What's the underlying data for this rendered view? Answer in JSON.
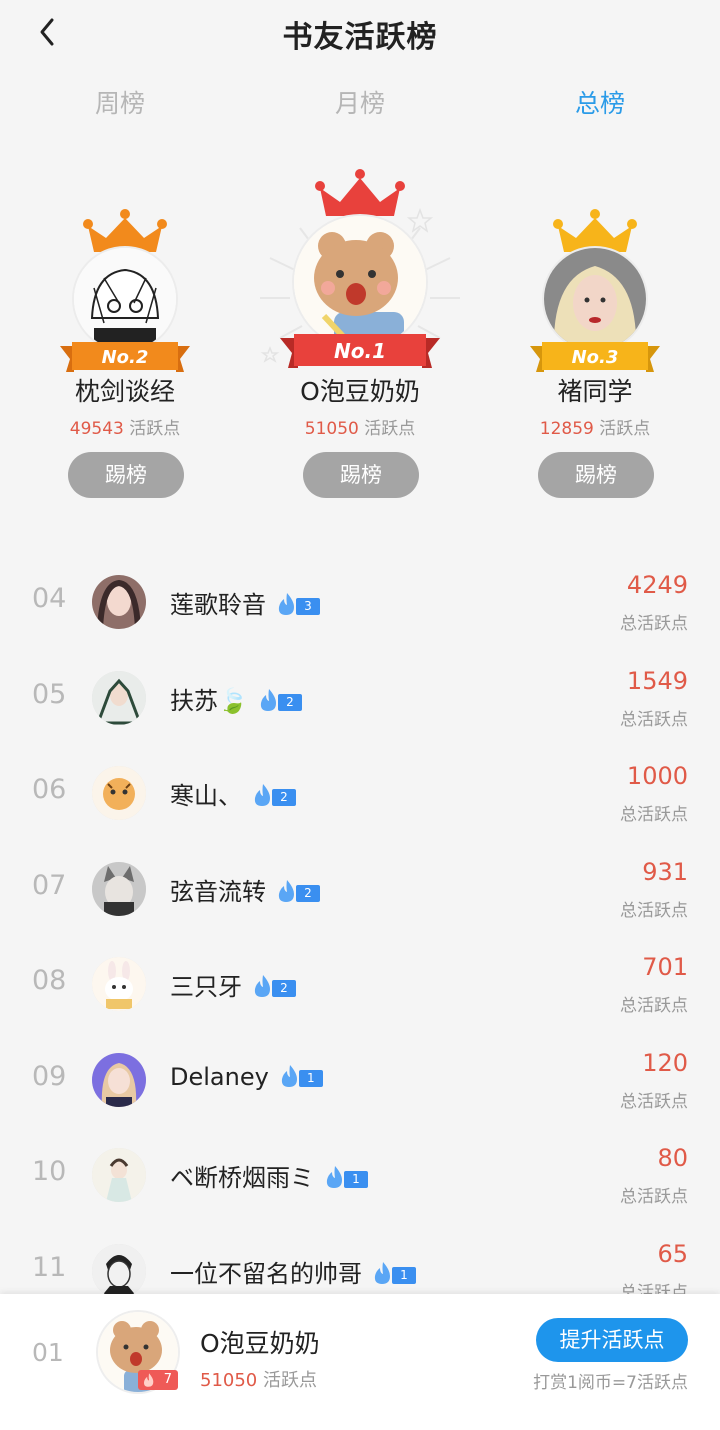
{
  "header": {
    "title": "书友活跃榜"
  },
  "tabs": [
    {
      "label": "周榜",
      "active": false
    },
    {
      "label": "月榜",
      "active": false
    },
    {
      "label": "总榜",
      "active": true
    }
  ],
  "podium": {
    "first": {
      "rank": "No.1",
      "name": "O泡豆奶奶",
      "score": "51050",
      "unit": "活跃点",
      "kick": "踢榜"
    },
    "second": {
      "rank": "No.2",
      "name": "枕剑谈经",
      "score": "49543",
      "unit": "活跃点",
      "kick": "踢榜"
    },
    "third": {
      "rank": "No.3",
      "name": "褚同学",
      "score": "12859",
      "unit": "活跃点",
      "kick": "踢榜"
    }
  },
  "list": [
    {
      "rank": "04",
      "name": "莲歌聆音",
      "level": "3",
      "score": "4249",
      "label": "总活跃点"
    },
    {
      "rank": "05",
      "name": "扶苏🍃",
      "level": "2",
      "score": "1549",
      "label": "总活跃点"
    },
    {
      "rank": "06",
      "name": "寒山、",
      "level": "2",
      "score": "1000",
      "label": "总活跃点"
    },
    {
      "rank": "07",
      "name": "弦音流转",
      "level": "2",
      "score": "931",
      "label": "总活跃点"
    },
    {
      "rank": "08",
      "name": "三只牙",
      "level": "2",
      "score": "701",
      "label": "总活跃点"
    },
    {
      "rank": "09",
      "name": "Delaney",
      "level": "1",
      "score": "120",
      "label": "总活跃点"
    },
    {
      "rank": "10",
      "name": "ベ断桥烟雨ミ",
      "level": "1",
      "score": "80",
      "label": "总活跃点"
    },
    {
      "rank": "11",
      "name": "一位不留名的帅哥",
      "level": "1",
      "score": "65",
      "label": "总活跃点"
    }
  ],
  "footer": {
    "rank": "01",
    "name": "O泡豆奶奶",
    "level": "7",
    "score": "51050",
    "unit": "活跃点",
    "button": "提升活跃点",
    "hint": "打赏1阅币=7活跃点"
  },
  "colors": {
    "accent": "#1e95ec",
    "score": "#e05a48",
    "gold": "#f7b41a",
    "red": "#e8413c",
    "orange": "#f28a1c"
  }
}
